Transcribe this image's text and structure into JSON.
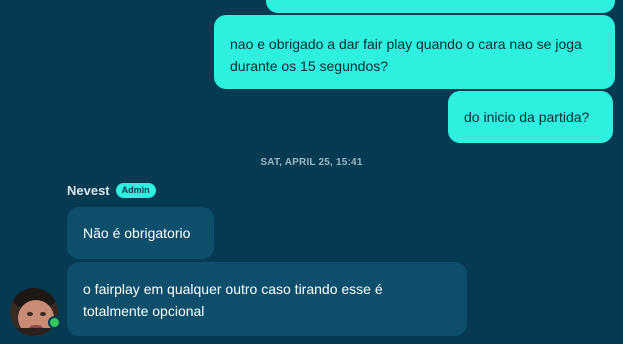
{
  "colors": {
    "background": "#053a52",
    "outgoing_bubble": "#2df0df",
    "incoming_bubble": "#0d4e6b",
    "online_status": "#35c759"
  },
  "messages_before": [
    {
      "direction": "outgoing",
      "text": ""
    },
    {
      "direction": "outgoing",
      "text": "nao e obrigado a dar fair play quando o cara nao se joga durante os 15 segundos?"
    },
    {
      "direction": "outgoing",
      "text": "do inicio da partida?"
    }
  ],
  "divider": {
    "timestamp": "SAT, APRIL 25, 15:41"
  },
  "group": {
    "sender": "Nevest",
    "badge": "Admin",
    "avatar_icon": "user-avatar-icon",
    "status_icon": "online-status-icon",
    "messages": [
      {
        "direction": "incoming",
        "text": "Não é obrigatorio"
      },
      {
        "direction": "incoming",
        "text": "o fairplay em qualquer outro caso tirando esse é totalmente opcional"
      }
    ]
  }
}
